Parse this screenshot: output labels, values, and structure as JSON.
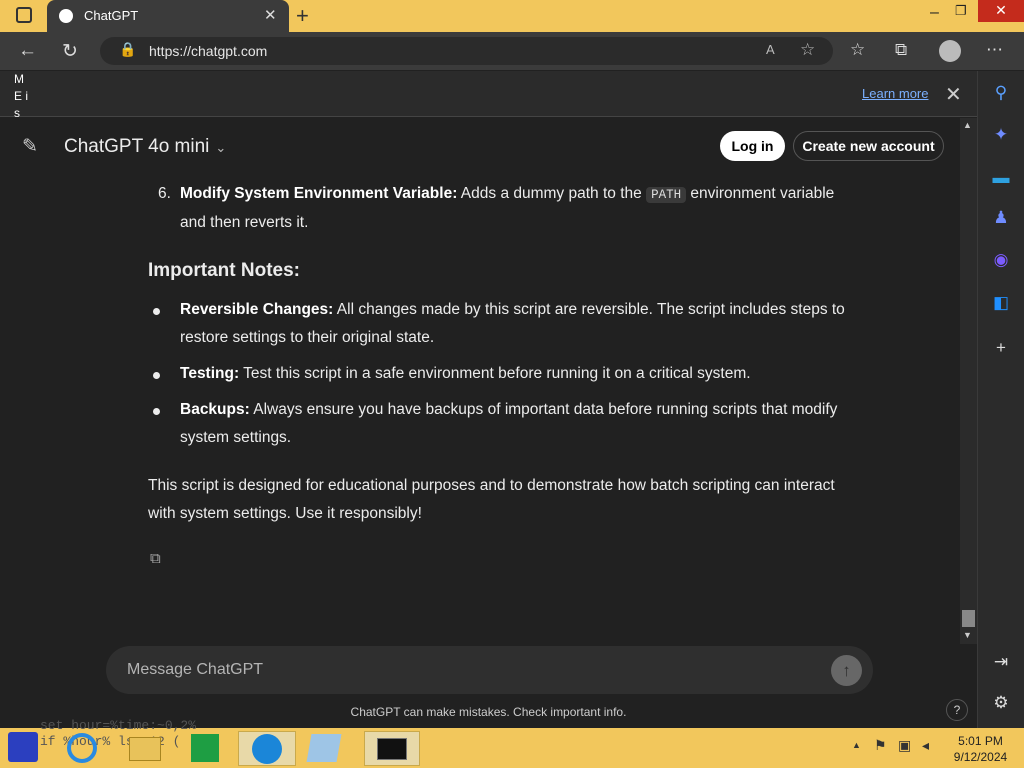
{
  "browser": {
    "tab_title": "ChatGPT",
    "tab_close": "✕",
    "new_tab": "+",
    "url": "https://chatgpt.com",
    "window_controls": {
      "minimize": "–",
      "restore": "❐",
      "close": "✕"
    }
  },
  "notification": {
    "text": "M E is",
    "learn_more": "Learn more",
    "close": "✕"
  },
  "chat_header": {
    "model": "ChatGPT 4o mini",
    "chevron": "⌄",
    "login": "Log in",
    "create_account": "Create new account"
  },
  "content": {
    "item6": {
      "number": "6.",
      "bold": "Modify System Environment Variable:",
      "text_before": " Adds a dummy path to the ",
      "code": "PATH",
      "text_after": " environment variable and then reverts it."
    },
    "notes_heading": "Important Notes:",
    "bullets": [
      {
        "bold": "Reversible Changes:",
        "text": " All changes made by this script are reversible. The script includes steps to restore settings to their original state."
      },
      {
        "bold": "Testing:",
        "text": " Test this script in a safe environment before running it on a critical system."
      },
      {
        "bold": "Backups:",
        "text": " Always ensure you have backups of important data before running scripts that modify system settings."
      }
    ],
    "closing": "This script is designed for educational purposes and to demonstrate how batch scripting can interact with system settings. Use it responsibly!"
  },
  "composer": {
    "placeholder": "Message ChatGPT",
    "send_icon": "↑",
    "disclaimer": "ChatGPT can make mistakes. Check important info.",
    "help": "?"
  },
  "taskbar": {
    "background_text_line1": "set hour=%time:~0,2%",
    "background_text_line2": "if %hour% lss 12 (",
    "time": "5:01 PM",
    "date": "9/12/2024"
  },
  "colors": {
    "accent_titlebar": "#f2c75c",
    "chat_bg": "#212121",
    "close_button": "#c42b1c"
  }
}
